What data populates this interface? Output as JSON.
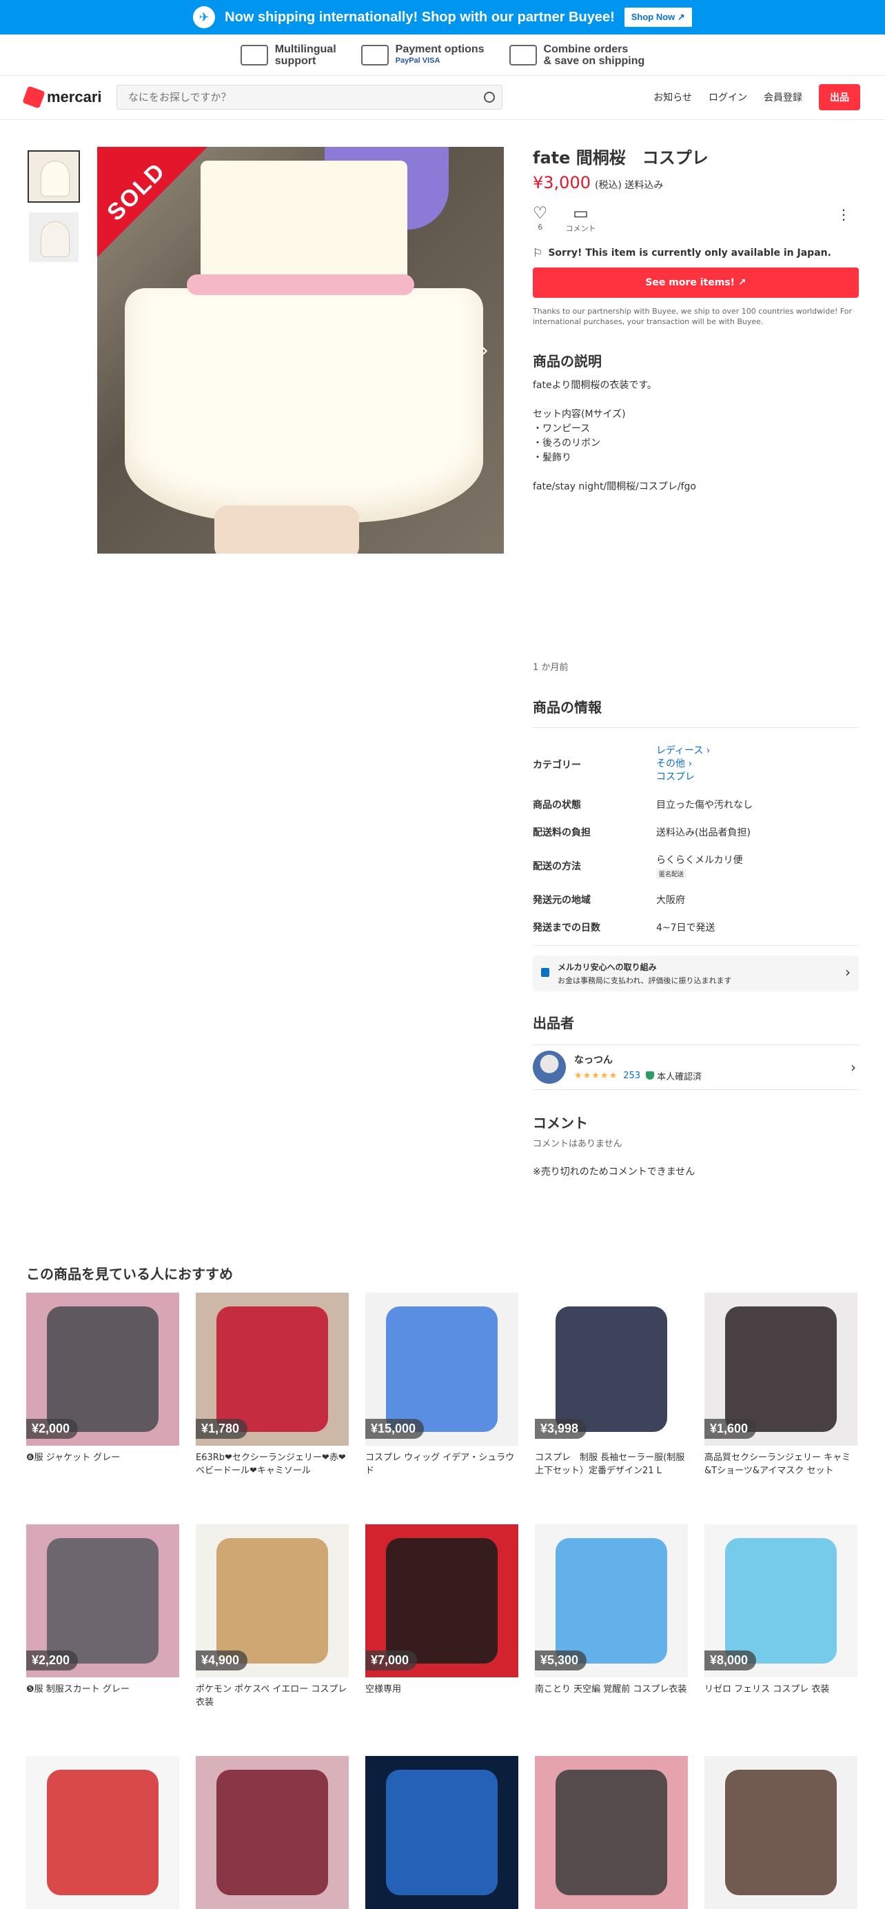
{
  "promo": {
    "text": "Now shipping internationally! Shop with our partner Buyee!",
    "shop_now": "Shop Now ↗"
  },
  "features": [
    {
      "title": "Multilingual",
      "sub": "support"
    },
    {
      "title": "Payment options",
      "sub": "PayPal VISA"
    },
    {
      "title": "Combine orders",
      "sub": "& save on shipping"
    }
  ],
  "header": {
    "brand": "mercari",
    "search_placeholder": "なにをお探しですか？",
    "nav": [
      "お知らせ",
      "ログイン",
      "会員登録"
    ],
    "sell": "出品"
  },
  "gallery": {
    "sold_label": "SOLD"
  },
  "item": {
    "title": "fate 間桐桜　コスプレ",
    "price": "¥3,000",
    "tax": "(税込) 送料込み",
    "likes": "6",
    "comment_label": "コメント",
    "notice": "Sorry! This item is currently only available in Japan.",
    "see_more": "See more items! ↗",
    "thanks": "Thanks to our partnership with Buyee, we ship to over 100 countries worldwide! For international purchases, your transaction will be with Buyee.",
    "desc_title": "商品の説明",
    "description": "fateより間桐桜の衣装です。\n\nセット内容(Mサイズ)\n・ワンピース\n・後ろのリボン\n・髪飾り\n\nfate/stay night/間桐桜/コスプレ/fgo",
    "posted": "1 か月前",
    "info_title": "商品の情報",
    "info": {
      "category_label": "カテゴリー",
      "categories": [
        "レディース ›",
        "その他 ›",
        "コスプレ"
      ],
      "condition_label": "商品の状態",
      "condition": "目立った傷や汚れなし",
      "shipping_fee_label": "配送料の負担",
      "shipping_fee": "送料込み(出品者負担)",
      "method_label": "配送の方法",
      "method": "らくらくメルカリ便",
      "method_chip": "匿名配送",
      "region_label": "発送元の地域",
      "region": "大阪府",
      "days_label": "発送までの日数",
      "days": "4~7日で発送"
    },
    "safe_title": "メルカリ安心への取り組み",
    "safe_text": "お金は事務局に支払われ、評価後に振り込まれます",
    "seller_title": "出品者",
    "seller_name": "なっつん",
    "seller_stars": "★★★★★",
    "seller_reviews": "253",
    "verified": "本人確認済",
    "comments_title": "コメント",
    "no_comments": "コメントはありません",
    "sold_note": "※売り切れのためコメントできません"
  },
  "recommend": {
    "title": "この商品を見ている人におすすめ",
    "items": [
      {
        "price": "¥2,000",
        "name": "❻服 ジャケット グレー",
        "color": "#4a4a4f",
        "bg": "#d7a5b4"
      },
      {
        "price": "¥1,780",
        "name": "E63Rb❤セクシーランジェリー❤赤❤ベビードール❤キャミソール",
        "color": "#c4142e",
        "bg": "#cdb7a6"
      },
      {
        "price": "¥15,000",
        "name": "コスプレ ウィッグ イデア・シュラウド",
        "color": "#3f7de0",
        "bg": "#f2f2f2"
      },
      {
        "price": "¥3,998",
        "name": "コスプレ　制服 長袖セーラー服(制服上下セット）定番デザイン21 L",
        "color": "#1c2240",
        "bg": "#ffffff"
      },
      {
        "price": "¥1,600",
        "name": "高品質セクシーランジェリー キャミ&Tショーツ&アイマスク セット",
        "color": "#2b2226",
        "bg": "#eceaea"
      },
      {
        "price": "¥2,200",
        "name": "❺服 制服スカート グレー",
        "color": "#5a5a60",
        "bg": "#d9a8b8"
      },
      {
        "price": "¥4,900",
        "name": "ポケモン ポケスペ イエロー コスプレ 衣装",
        "color": "#c79a5e",
        "bg": "#f3f1ec"
      },
      {
        "price": "¥7,000",
        "name": "空様専用",
        "color": "#1b1b1b",
        "bg": "#d3232e"
      },
      {
        "price": "¥5,300",
        "name": "南ことり 天空編 覚醒前 コスプレ衣装",
        "color": "#49a5e8",
        "bg": "#f4f4f4"
      },
      {
        "price": "¥8,000",
        "name": "リゼロ フェリス コスプレ 衣装",
        "color": "#5ec3e6",
        "bg": "#f5f5f5"
      }
    ],
    "partial_row": [
      {
        "color": "#d42a2a",
        "bg": "#f6f6f6"
      },
      {
        "color": "#7a2231",
        "bg": "#d9b1bb"
      },
      {
        "color": "#2a6dcc",
        "bg": "#0b1e3b"
      },
      {
        "color": "#3c3c3c",
        "bg": "#e5a4ad"
      },
      {
        "color": "#5a3f33",
        "bg": "#f2f2f2"
      }
    ]
  }
}
